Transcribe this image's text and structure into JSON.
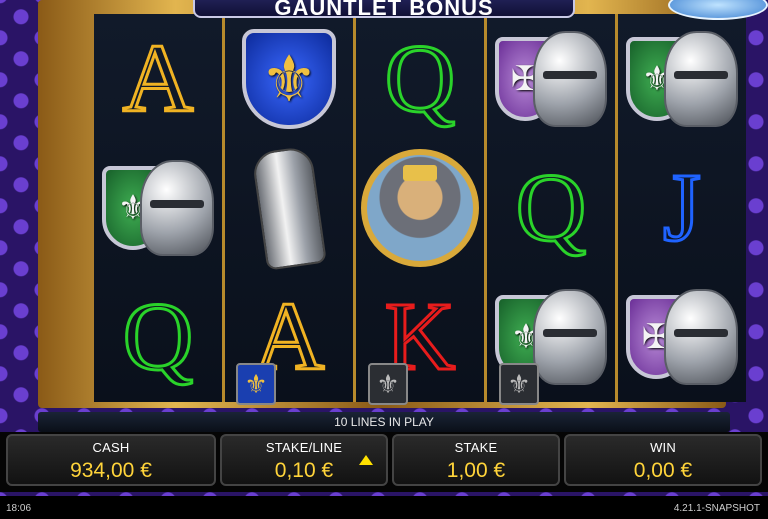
{
  "header": {
    "title": "GAUNTLET BONUS"
  },
  "reels": [
    {
      "symbols": [
        {
          "type": "letter",
          "label": "A",
          "color": "#f0b323"
        },
        {
          "type": "shield-helmet",
          "shield": "green",
          "name": "green-shield-helmet"
        },
        {
          "type": "letter",
          "label": "Q",
          "color": "#2ad32a"
        }
      ]
    },
    {
      "symbols": [
        {
          "type": "blue-shield",
          "name": "blue-fleur-shield"
        },
        {
          "type": "gauntlet",
          "name": "gauntlet"
        },
        {
          "type": "letter",
          "label": "A",
          "color": "#f0b323"
        }
      ]
    },
    {
      "symbols": [
        {
          "type": "letter",
          "label": "Q",
          "color": "#2ad32a"
        },
        {
          "type": "king",
          "name": "king-portrait"
        },
        {
          "type": "letter",
          "label": "K",
          "color": "#e81c1c"
        }
      ]
    },
    {
      "symbols": [
        {
          "type": "shield-helmet",
          "shield": "purple",
          "name": "purple-shield-helmet"
        },
        {
          "type": "letter",
          "label": "Q",
          "color": "#2ad32a"
        },
        {
          "type": "shield-helmet",
          "shield": "green",
          "name": "green-shield-helmet"
        }
      ]
    },
    {
      "symbols": [
        {
          "type": "shield-helmet",
          "shield": "green",
          "name": "green-shield-helmet"
        },
        {
          "type": "letter",
          "label": "J",
          "color": "#1f63ff"
        },
        {
          "type": "shield-helmet",
          "shield": "purple",
          "name": "purple-shield-helmet"
        }
      ]
    }
  ],
  "lines_bar": {
    "text": "10 LINES IN PLAY"
  },
  "console": {
    "cash": {
      "label": "CASH",
      "value": "934,00 €"
    },
    "stake_line": {
      "label": "STAKE/LINE",
      "value": "0,10 €"
    },
    "stake": {
      "label": "STAKE",
      "value": "1,00 €"
    },
    "win": {
      "label": "WIN",
      "value": "0,00 €"
    }
  },
  "status": {
    "clock": "18:06",
    "version": "4.21.1-SNAPSHOT"
  },
  "colors": {
    "accent_yellow": "#ffd43a",
    "frame_gold": "#e2b54f",
    "background_purple": "#2a1466"
  }
}
